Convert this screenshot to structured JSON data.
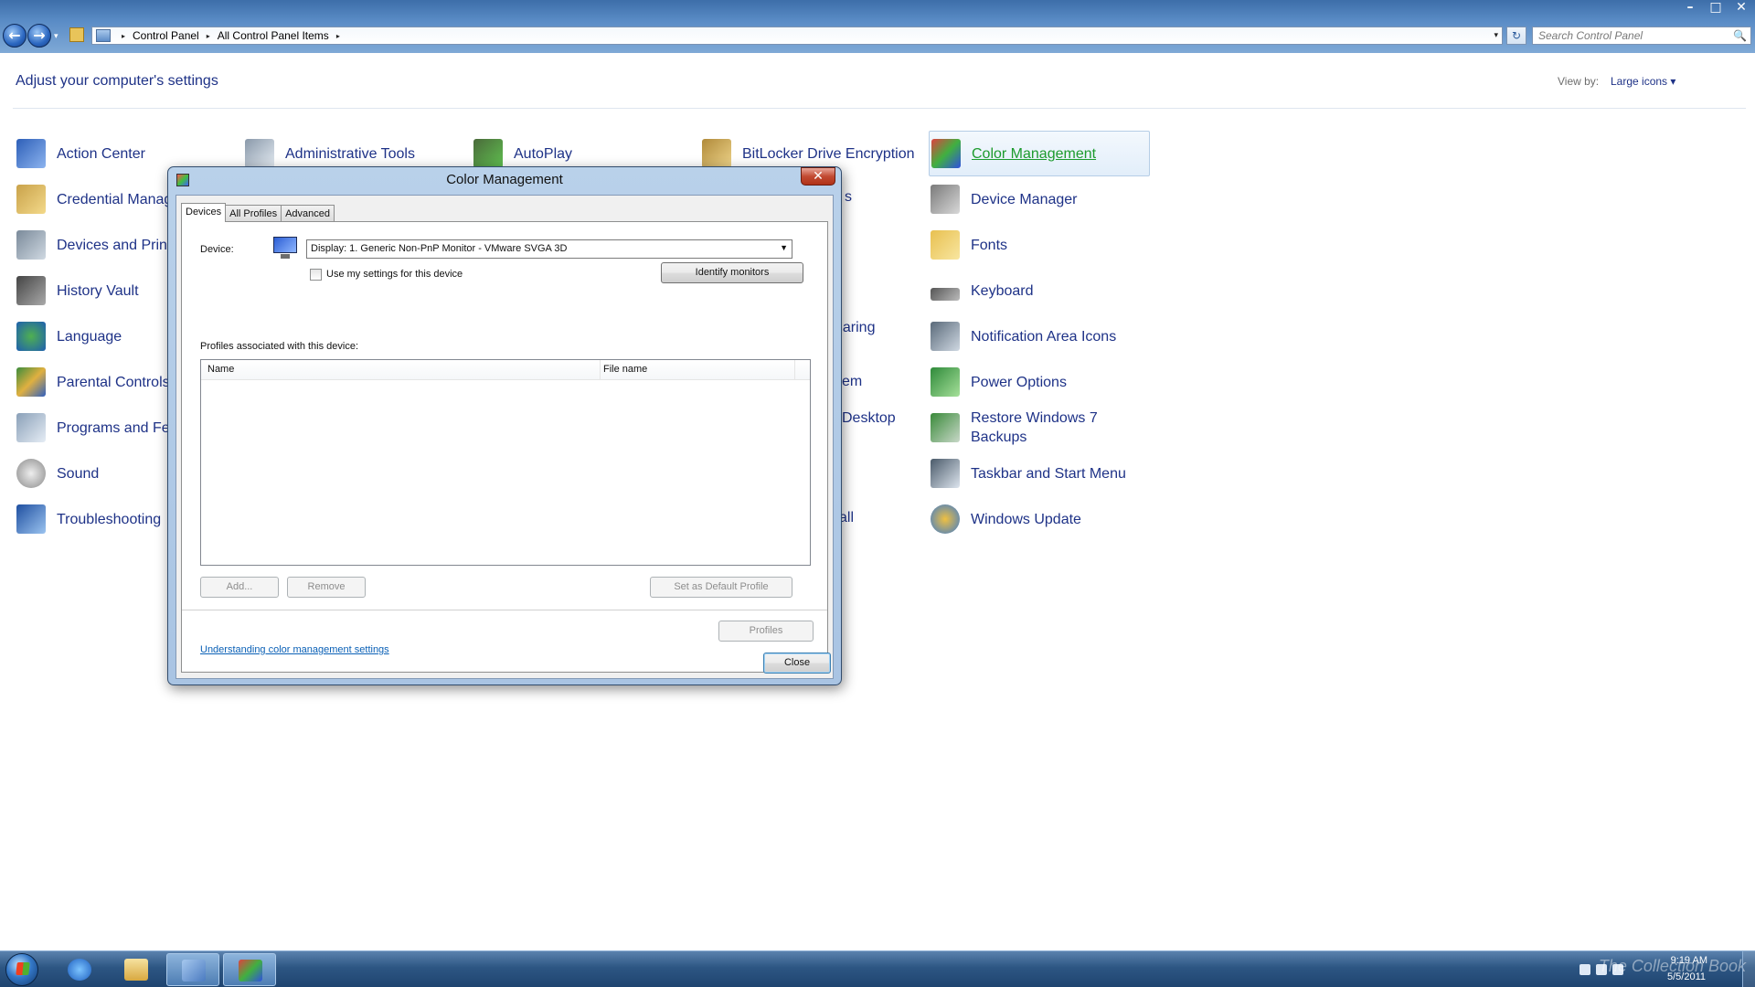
{
  "window": {
    "controls": {
      "minimize": "–",
      "maximize": "□",
      "close": "✕"
    }
  },
  "nav": {
    "back_icon": "back-arrow-icon",
    "forward_icon": "forward-arrow-icon",
    "back_glyph": "←",
    "forward_glyph": "→",
    "dropdown_glyph": "▾"
  },
  "address": {
    "breadcrumb": [
      "Control Panel",
      "All Control Panel Items"
    ],
    "separator": "▸"
  },
  "search": {
    "placeholder": "Search Control Panel",
    "icon": "🔍"
  },
  "refresh_glyph": "↻",
  "header": {
    "title": "Adjust your computer's settings",
    "view_by_label": "View by:",
    "view_by_value": "Large icons ▾"
  },
  "items": {
    "col1": [
      "Action Center",
      "Credential Manager",
      "Devices and Printers",
      "History Vault",
      "Language",
      "Parental Controls",
      "Programs and Features",
      "Sound",
      "Troubleshooting"
    ],
    "col2": [
      "Administrative Tools"
    ],
    "col3": [
      "AutoPlay"
    ],
    "col4": [
      "BitLocker Drive Encryption"
    ],
    "col4_partial": [
      "s",
      "haring",
      "em",
      "l Desktop",
      "all"
    ],
    "col5": [
      "Color Management",
      "Device Manager",
      "Fonts",
      "Keyboard",
      "Notification Area Icons",
      "Power Options",
      "Restore Windows 7 Backups",
      "Taskbar and Start Menu",
      "Windows Update"
    ]
  },
  "dialog": {
    "title": "Color Management",
    "close_glyph": "✕",
    "tabs": [
      "Devices",
      "All Profiles",
      "Advanced"
    ],
    "device_label": "Device:",
    "device_value": "Display: 1. Generic Non-PnP Monitor - VMware SVGA 3D",
    "use_settings_label": "Use my settings for this device",
    "identify_button": "Identify monitors",
    "profiles_label": "Profiles associated with this device:",
    "columns": [
      "Name",
      "File name"
    ],
    "add_button": "Add...",
    "remove_button": "Remove",
    "set_default_button": "Set as Default Profile",
    "link": "Understanding color management settings",
    "profiles_button": "Profiles",
    "close_button": "Close"
  },
  "taskbar": {
    "time": "9:19 AM",
    "date": "5/5/2011",
    "watermark": "The Collection Book"
  },
  "colors": {
    "link_blue": "#1e3287",
    "selected_green": "#1d9b2d",
    "dialog_frame": "#b9d1ea"
  }
}
